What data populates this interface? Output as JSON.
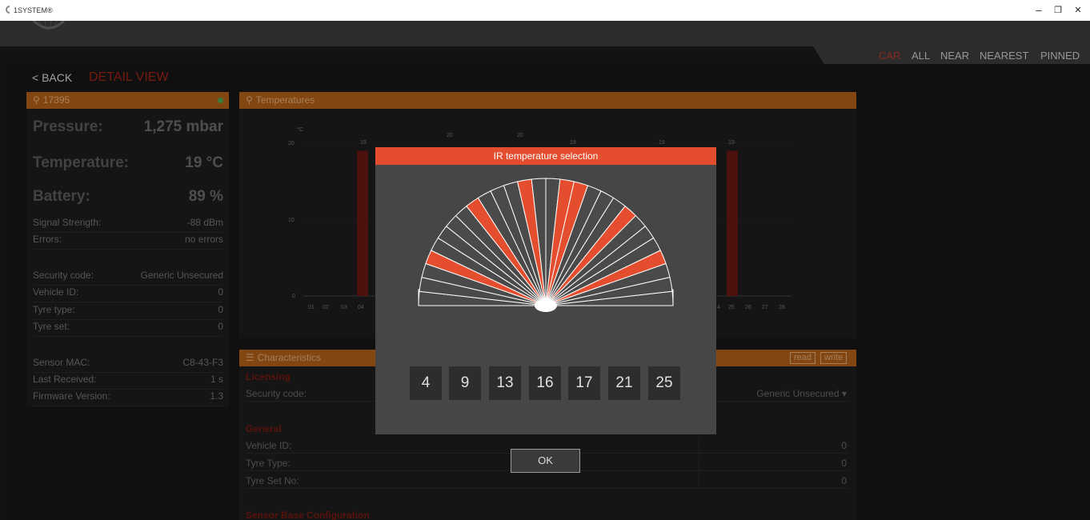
{
  "window": {
    "title": "1SYSTEM®",
    "minimize": "–",
    "restore": "❐",
    "close": "✕"
  },
  "nav": {
    "items": [
      "CAR",
      "ALL",
      "NEAR",
      "NEAREST",
      "PINNED"
    ],
    "active": "CAR"
  },
  "detail": {
    "back_label": "< BACK",
    "title": "DETAIL VIEW"
  },
  "sensor": {
    "id": "17395",
    "pressure_label": "Pressure:",
    "pressure_value": "1,275 mbar",
    "temperature_label": "Temperature:",
    "temperature_value": "19 °C",
    "battery_label": "Battery:",
    "battery_value": "89 %",
    "signal_label": "Signal Strength:",
    "signal_value": "-88 dBm",
    "errors_label": "Errors:",
    "errors_value": "no errors",
    "security_label": "Security code:",
    "security_value": "Generic Unsecured",
    "vehicle_label": "Vehicle ID:",
    "vehicle_value": "0",
    "tyre_type_label": "Tyre type:",
    "tyre_type_value": "0",
    "tyre_set_label": "Tyre set:",
    "tyre_set_value": "0",
    "mac_label": "Sensor MAC:",
    "mac_value": "C8-43-F3",
    "last_received_label": "Last Received:",
    "last_received_value": "1 s",
    "firmware_label": "Firmware Version:",
    "firmware_value": "1.3"
  },
  "temperatures": {
    "title": "Temperatures",
    "unit": "°C",
    "y_ticks": [
      "20",
      "10",
      "0"
    ],
    "x_ticks_left": [
      "01",
      "02",
      "03",
      "04"
    ],
    "x_ticks_right": [
      "4",
      "25",
      "26",
      "27",
      "28"
    ],
    "bar_labels": [
      "19",
      "20",
      "20",
      "19",
      "19",
      "19"
    ]
  },
  "chart_data": {
    "type": "bar",
    "ylim": [
      0,
      20
    ],
    "visible_bars": [
      {
        "x": "04",
        "value": 19
      },
      {
        "x": "25",
        "value": 19
      }
    ]
  },
  "characteristics": {
    "title": "Characteristics",
    "read_label": "read",
    "write_label": "write",
    "licensing_title": "Licensing",
    "security_label": "Security code:",
    "security_value": "Generic Unsecured ▾",
    "general_title": "General",
    "vehicle_label": "Vehicle ID:",
    "vehicle_value": "0",
    "tyre_type_label": "Tyre Type:",
    "tyre_type_value": "0",
    "tyre_set_label": "Tyre Set No:",
    "tyre_set_value": "0",
    "base_config_title": "Sensor Base Configuration"
  },
  "ir_dialog": {
    "title": "IR temperature selection",
    "selected": [
      "4",
      "9",
      "13",
      "16",
      "17",
      "21",
      "25"
    ],
    "segments_total": 28,
    "highlight_color": "#e44d2e"
  },
  "ok_label": "OK",
  "colors": {
    "accent_red": "#c0392b",
    "panel_header": "#b5621a",
    "dialog_header": "#e44d2e"
  }
}
